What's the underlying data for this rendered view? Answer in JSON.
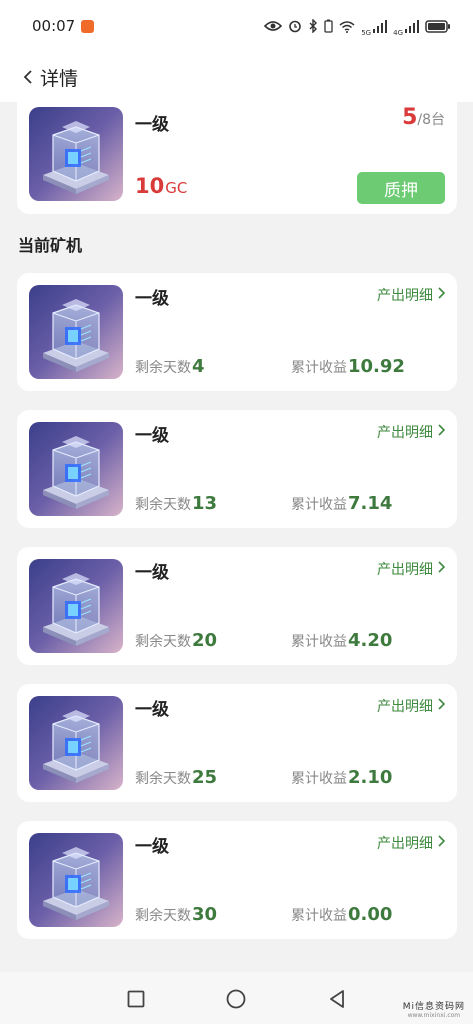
{
  "status_bar": {
    "time": "00:07",
    "network": "5G",
    "network2": "4G"
  },
  "nav": {
    "title": "详情"
  },
  "product": {
    "level": "一级",
    "stock_count": "5",
    "stock_total": "/8台",
    "price_value": "10",
    "price_unit": "GC",
    "stake_label": "质押"
  },
  "section": {
    "title": "当前矿机"
  },
  "miners": [
    {
      "level": "一级",
      "detail_label": "产出明细",
      "days_label": "剩余天数",
      "days_value": "4",
      "earn_label": "累计收益",
      "earn_value": "10.92"
    },
    {
      "level": "一级",
      "detail_label": "产出明细",
      "days_label": "剩余天数",
      "days_value": "13",
      "earn_label": "累计收益",
      "earn_value": "7.14"
    },
    {
      "level": "一级",
      "detail_label": "产出明细",
      "days_label": "剩余天数",
      "days_value": "20",
      "earn_label": "累计收益",
      "earn_value": "4.20"
    },
    {
      "level": "一级",
      "detail_label": "产出明细",
      "days_label": "剩余天数",
      "days_value": "25",
      "earn_label": "累计收益",
      "earn_value": "2.10"
    },
    {
      "level": "一级",
      "detail_label": "产出明细",
      "days_label": "剩余天数",
      "days_value": "30",
      "earn_label": "累计收益",
      "earn_value": "0.00"
    }
  ],
  "watermark": {
    "main": "Mi信息资码网",
    "sub": "www.mixinxi.com"
  },
  "colors": {
    "accent_green": "#6ccb73",
    "value_green": "#3e7a3e",
    "price_red": "#d93a3a"
  }
}
